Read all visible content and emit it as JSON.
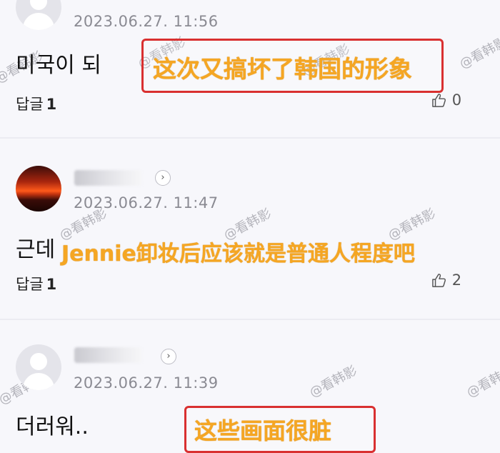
{
  "comments": [
    {
      "timestamp": "2023.06.27. 11:56",
      "text": "미국이 되",
      "reply_label": "답글",
      "reply_count": "1",
      "likes": "0",
      "avatar": "default-avatar"
    },
    {
      "timestamp": "2023.06.27. 11:47",
      "text": "근데",
      "reply_label": "답글",
      "reply_count": "1",
      "likes": "2",
      "avatar": "sunset-avatar"
    },
    {
      "timestamp": "2023.06.27. 11:39",
      "text": "더러워..",
      "avatar": "default-avatar"
    }
  ],
  "overlays": [
    "这次又搞坏了韩国的形象",
    "Jennie卸妆后应该就是普通人程度吧",
    "这些画面很脏"
  ],
  "watermark": "@看韩影",
  "colors": {
    "overlay_text": "#f5a623",
    "overlay_box": "#d93030",
    "background": "#f7f7fb"
  },
  "icons": {
    "like": "thumbs-up-icon",
    "expand": "chevron-right-icon"
  }
}
